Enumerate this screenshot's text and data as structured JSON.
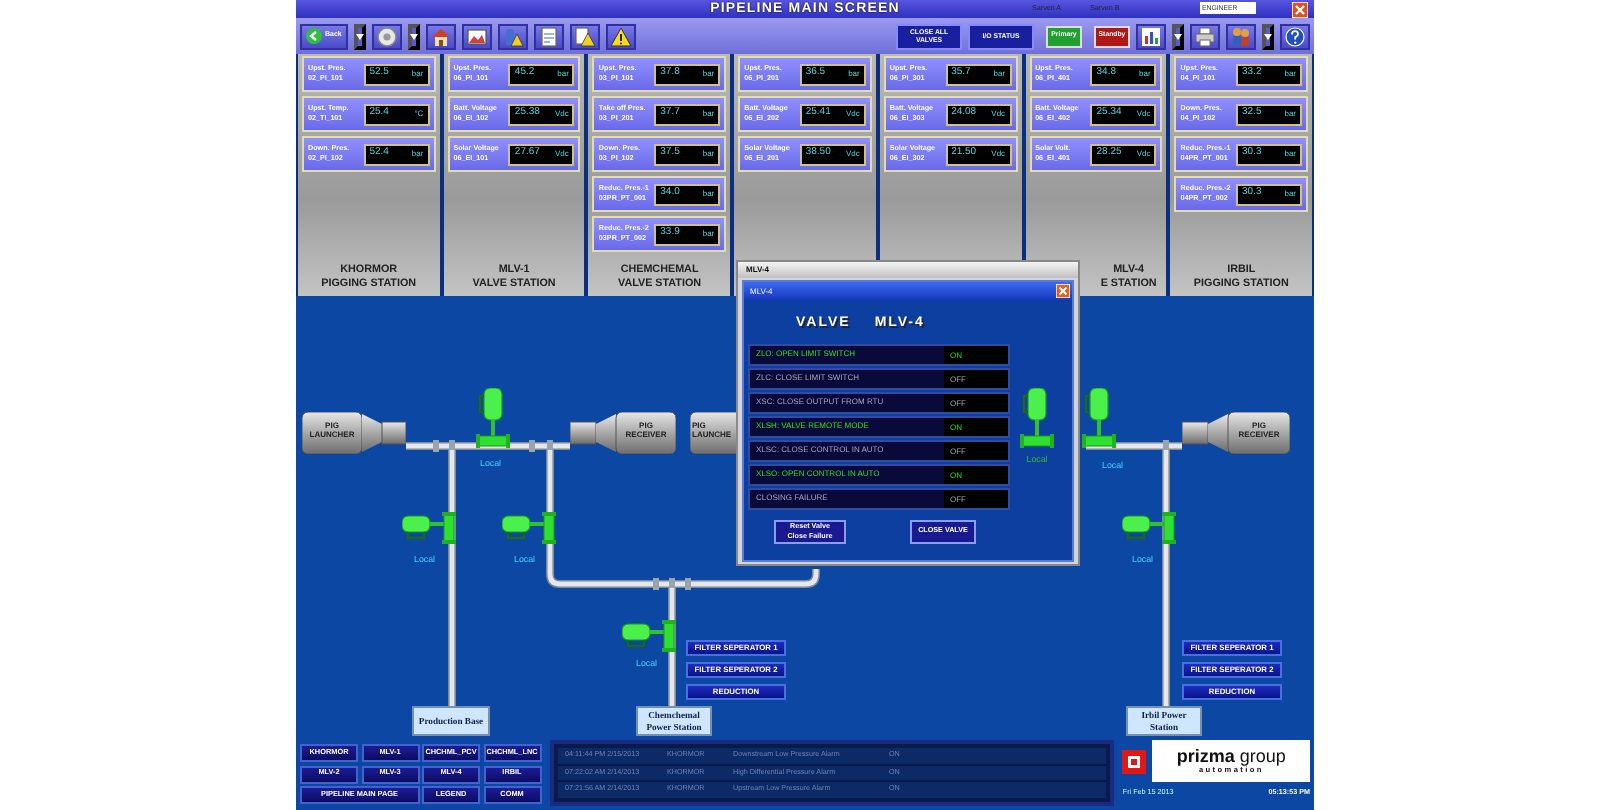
{
  "title_bar": {
    "title": "PIPELINE MAIN SCREEN",
    "servers": [
      "Sarven A",
      "Sarven B"
    ],
    "user": "ENGINEER"
  },
  "toolbar": {
    "back": "Back",
    "commands": [
      "CLOSE ALL VALVES",
      "I/O STATUS"
    ],
    "servers": [
      {
        "label": "Primary",
        "kind": "primary"
      },
      {
        "label": "Standby",
        "kind": "standby"
      }
    ]
  },
  "stations": [
    {
      "name": [
        "KHORMOR",
        "PIGGING STATION"
      ],
      "readouts": [
        {
          "label": "Upst. Pres.",
          "tag": "02_PI_101",
          "value": "52.5",
          "unit": "bar"
        },
        {
          "label": "Upst. Temp.",
          "tag": "02_TI_101",
          "value": "25.4",
          "unit": "°C"
        },
        {
          "label": "Down. Pres.",
          "tag": "02_PI_102",
          "value": "52.4",
          "unit": "bar"
        }
      ]
    },
    {
      "name": [
        "MLV-1",
        "VALVE STATION"
      ],
      "readouts": [
        {
          "label": "Upst. Pres.",
          "tag": "06_PI_101",
          "value": "45.2",
          "unit": "bar"
        },
        {
          "label": "Batt. Voltage",
          "tag": "06_EI_102",
          "value": "25.38",
          "unit": "Vdc"
        },
        {
          "label": "Solar Voltage",
          "tag": "06_EI_101",
          "value": "27.67",
          "unit": "Vdc"
        }
      ]
    },
    {
      "name": [
        "CHEMCHEMAL",
        "VALVE STATION"
      ],
      "readouts": [
        {
          "label": "Upst. Pres.",
          "tag": "03_PI_101",
          "value": "37.8",
          "unit": "bar"
        },
        {
          "label": "Take off Pres.",
          "tag": "03_PI_201",
          "value": "37.7",
          "unit": "bar"
        },
        {
          "label": "Down. Pres.",
          "tag": "03_PI_102",
          "value": "37.5",
          "unit": "bar"
        },
        {
          "label": "Reduc. Pres.-1",
          "tag": "03PR_PT_001",
          "value": "34.0",
          "unit": "bar"
        },
        {
          "label": "Reduc. Pres.-2",
          "tag": "03PR_PT_002",
          "value": "33.9",
          "unit": "bar"
        }
      ]
    },
    {
      "readouts": [
        {
          "label": "Upst. Pres.",
          "tag": "06_PI_201",
          "value": "36.5",
          "unit": "bar"
        },
        {
          "label": "Batt. Voltage",
          "tag": "06_EI_202",
          "value": "25.41",
          "unit": "Vdc"
        },
        {
          "label": "Solar Voltage",
          "tag": "06_EI_201",
          "value": "38.50",
          "unit": "Vdc"
        }
      ]
    },
    {
      "readouts": [
        {
          "label": "Upst. Pres.",
          "tag": "06_PI_301",
          "value": "35.7",
          "unit": "bar"
        },
        {
          "label": "Batt. Voltage",
          "tag": "06_EI_303",
          "value": "24.08",
          "unit": "Vdc"
        },
        {
          "label": "Solar Voltage",
          "tag": "06_EI_302",
          "value": "21.50",
          "unit": "Vdc"
        }
      ]
    },
    {
      "name": [
        "MLV-4",
        "E STATION"
      ],
      "readouts": [
        {
          "label": "Upst. Pres.",
          "tag": "06_PI_401",
          "value": "34.8",
          "unit": "bar"
        },
        {
          "label": "Batt. Voltage",
          "tag": "06_EI_402",
          "value": "25.34",
          "unit": "Vdc"
        },
        {
          "label": "Solar Volt.",
          "tag": "06_EI_401",
          "value": "28.25",
          "unit": "Vdc"
        }
      ]
    },
    {
      "name": [
        "IRBIL",
        "PIGGING STATION"
      ],
      "readouts": [
        {
          "label": "Upst. Pres.",
          "tag": "04_PI_101",
          "value": "33.2",
          "unit": "bar"
        },
        {
          "label": "Down. Pres.",
          "tag": "04_PI_102",
          "value": "32.5",
          "unit": "bar"
        },
        {
          "label": "Reduc. Pres.-1",
          "tag": "04PR_PT_001",
          "value": "30.3",
          "unit": "bar"
        },
        {
          "label": "Reduc. Pres.-2",
          "tag": "04PR_PT_002",
          "value": "30.3",
          "unit": "bar"
        }
      ]
    }
  ],
  "diagram": {
    "equipment": [
      {
        "kind": "launcher",
        "lines": [
          "PIG",
          "LAUNCHER"
        ]
      },
      {
        "kind": "receiver",
        "lines": [
          "PIG",
          "RECEIVER"
        ]
      },
      {
        "kind": "launcher",
        "lines": [
          "PIG",
          "LAUNCHE"
        ]
      },
      {
        "kind": "receiver",
        "lines": [
          "PIG",
          "RECEIVER"
        ]
      }
    ],
    "valves": [
      {
        "kind": "vertical",
        "mode": "Local"
      },
      {
        "kind": "horizontal",
        "mode": "Local"
      },
      {
        "kind": "horizontal",
        "mode": "Local"
      },
      {
        "kind": "horizontal",
        "mode": "Local"
      },
      {
        "kind": "vertical",
        "mode": "Local"
      },
      {
        "kind": "horizontal",
        "mode": "Local"
      }
    ],
    "filter_groups": [
      [
        "FILTER SEPERATOR 1",
        "FILTER SEPERATOR 2",
        "REDUCTION"
      ],
      [
        "FILTER SEPERATOR 1",
        "FILTER SEPERATOR 2",
        "REDUCTION"
      ]
    ],
    "destinations": [
      "Production Base",
      "Chemchemal Power Station",
      "Irbil Power Station"
    ]
  },
  "dialog": {
    "window_title": "MLV-4",
    "title": "MLV-4",
    "heading": [
      "VALVE",
      "MLV-4"
    ],
    "rows": [
      {
        "label": "ZLO: OPEN LIMIT SWITCH",
        "status": "ON",
        "on": true
      },
      {
        "label": "ZLC: CLOSE LIMIT SWITCH",
        "status": "OFF",
        "on": false
      },
      {
        "label": "XSC: CLOSE OUTPUT FROM RTU",
        "status": "OFF",
        "on": false
      },
      {
        "label": "XLSH: VALVE REMOTE MODE",
        "status": "ON",
        "on": true
      },
      {
        "label": "XLSC: CLOSE CONTROL IN AUTO",
        "status": "OFF",
        "on": false
      },
      {
        "label": "XLSO: OPEN CONTROL IN AUTO",
        "status": "ON",
        "on": true
      },
      {
        "label": "CLOSING FAILURE",
        "status": "OFF",
        "on": false
      }
    ],
    "buttons": [
      "Reset Valve Close Failure",
      "CLOSE VALVE"
    ],
    "valve_mode": "Local"
  },
  "navigation": [
    {
      "label": "KHORMOR"
    },
    {
      "label": "MLV-1"
    },
    {
      "label": "CHCHML_PCV"
    },
    {
      "label": "CHCHML_LNC"
    },
    {
      "label": "MLV-2"
    },
    {
      "label": "MLV-3"
    },
    {
      "label": "MLV-4"
    },
    {
      "label": "IRBIL"
    },
    {
      "label": "PIPELINE MAIN PAGE",
      "wide": true
    },
    {
      "label": "LEGEND"
    },
    {
      "label": "COMM"
    }
  ],
  "alarms": [
    {
      "time": "04:11:44 PM 2/15/2013",
      "station": "KHORMOR",
      "message": "Downstream Low Pressure Alarm",
      "state": "ON"
    },
    {
      "time": "07:22:02 AM 2/14/2013",
      "station": "KHORMOR",
      "message": "High Differential Pressure Alarm",
      "state": "ON"
    },
    {
      "time": "07:21:56 AM 2/14/2013",
      "station": "KHORMOR",
      "message": "Upstream Low Pressure Alarm",
      "state": "ON"
    }
  ],
  "footer": {
    "logo": {
      "brand": "prizma",
      "word": "group",
      "sub": "automation"
    },
    "date": "Fri Feb 15 2013",
    "time": "05:13:53 PM"
  }
}
